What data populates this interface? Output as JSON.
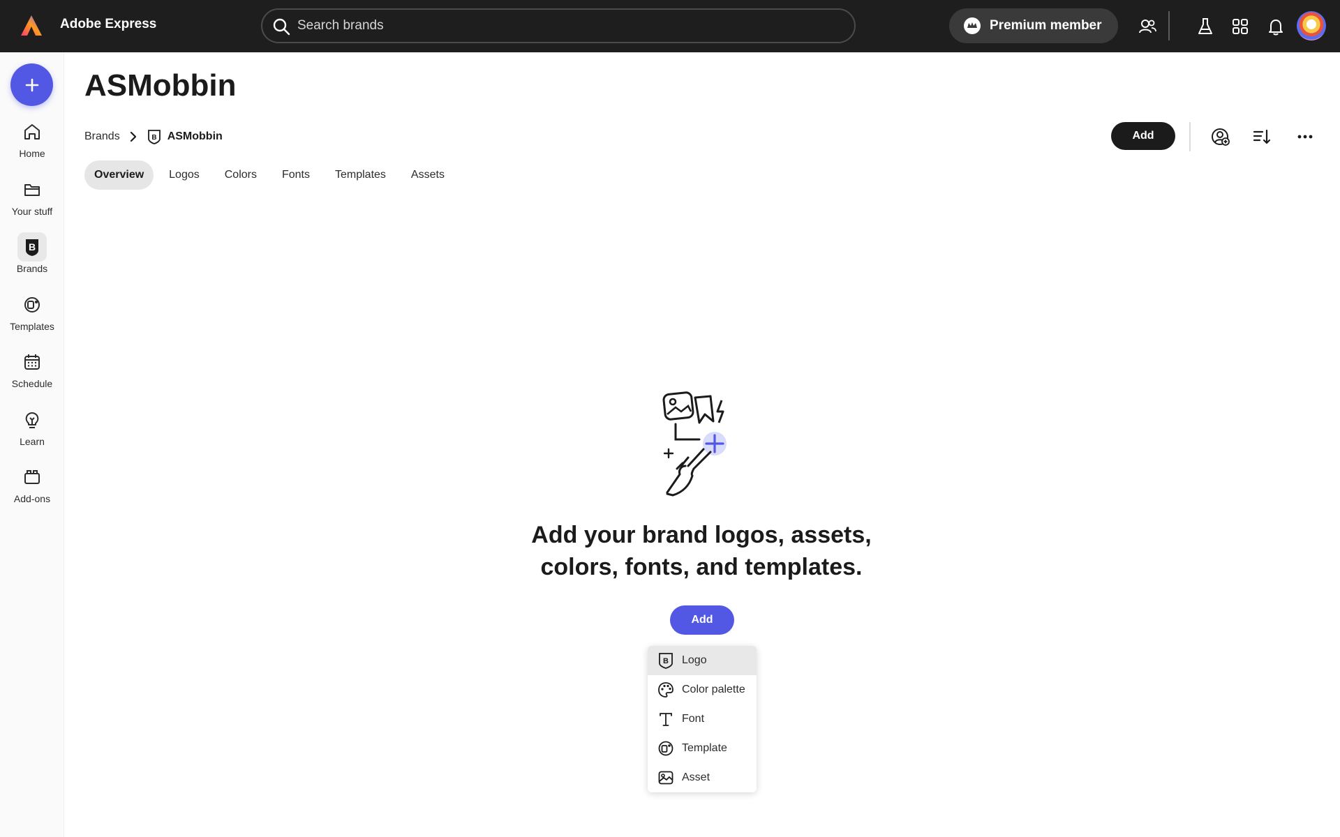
{
  "app": {
    "name": "Adobe Express"
  },
  "search": {
    "placeholder": "Search brands"
  },
  "premium": {
    "label": "Premium member"
  },
  "rail": {
    "items": [
      {
        "label": "Home",
        "icon": "home-icon"
      },
      {
        "label": "Your stuff",
        "icon": "folder-icon"
      },
      {
        "label": "Brands",
        "icon": "brand-icon"
      },
      {
        "label": "Templates",
        "icon": "templates-icon"
      },
      {
        "label": "Schedule",
        "icon": "calendar-icon"
      },
      {
        "label": "Learn",
        "icon": "lightbulb-icon"
      },
      {
        "label": "Add-ons",
        "icon": "addons-icon"
      }
    ]
  },
  "page": {
    "title": "ASMobbin"
  },
  "breadcrumb": {
    "root": "Brands",
    "current": "ASMobbin"
  },
  "toolbar": {
    "add_label": "Add"
  },
  "tabs": [
    "Overview",
    "Logos",
    "Colors",
    "Fonts",
    "Templates",
    "Assets"
  ],
  "empty_state": {
    "line1": "Add your brand logos, assets,",
    "line2": "colors, fonts, and templates.",
    "add_label": "Add"
  },
  "add_menu": {
    "items": [
      {
        "label": "Logo",
        "icon": "brand-logo-icon"
      },
      {
        "label": "Color palette",
        "icon": "palette-icon"
      },
      {
        "label": "Font",
        "icon": "font-icon"
      },
      {
        "label": "Template",
        "icon": "template-icon"
      },
      {
        "label": "Asset",
        "icon": "image-icon"
      }
    ]
  },
  "colors": {
    "accent": "#5258e4",
    "topbar": "#1e1e1e"
  }
}
